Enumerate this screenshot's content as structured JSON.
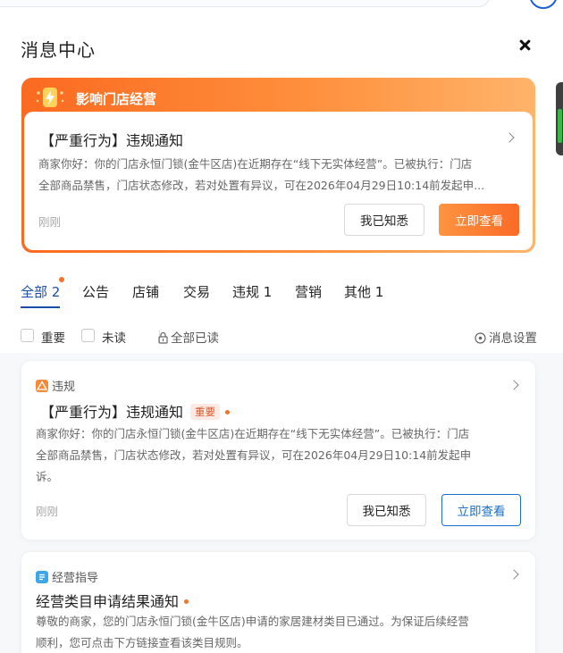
{
  "panel": {
    "title": "消息中心"
  },
  "highlight": {
    "header": "影响门店经营",
    "title": "【严重行为】违规通知",
    "desc_line1": "商家你好：你的门店永恒门锁(金牛区店)在近期存在“线下无实体经营”。已被执行：门店",
    "desc_line2": "全部商品禁售，门店状态修改，若对处置有异议，可在2026年04月29日10:14前发起申...",
    "time": "刚刚",
    "ack_label": "我已知悉",
    "view_label": "立即查看"
  },
  "tabs": [
    {
      "label": "全部 2"
    },
    {
      "label": "公告"
    },
    {
      "label": "店铺"
    },
    {
      "label": "交易"
    },
    {
      "label": "违规 1"
    },
    {
      "label": "营销"
    },
    {
      "label": "其他 1"
    }
  ],
  "filters": {
    "important": "重要",
    "unread": "未读",
    "mark_all_read": "全部已读",
    "settings": "消息设置"
  },
  "messages": [
    {
      "category": "违规",
      "title": "【严重行为】违规通知",
      "tag": "重要",
      "desc_line1": "商家你好：你的门店永恒门锁(金牛区店)在近期存在“线下无实体经营”。已被执行：门店",
      "desc_line2": "全部商品禁售，门店状态修改，若对处置有异议，可在2026年04月29日10:14前发起申",
      "desc_line3": "诉。",
      "time": "刚刚",
      "ack_label": "我已知悉",
      "view_label": "立即查看"
    },
    {
      "category": "经营指导",
      "title": "经营类目申请结果通知",
      "desc_line1": "尊敬的商家，您的门店永恒门锁(金牛区店)申请的家居建材类目已通过。为保证后续经营",
      "desc_line2": "顺利，您可点击下方链接查看该类目规则。"
    }
  ],
  "colors": {
    "accent_blue": "#1b4ea8",
    "orange": "#fb6a21",
    "important_red": "#e0562a"
  }
}
